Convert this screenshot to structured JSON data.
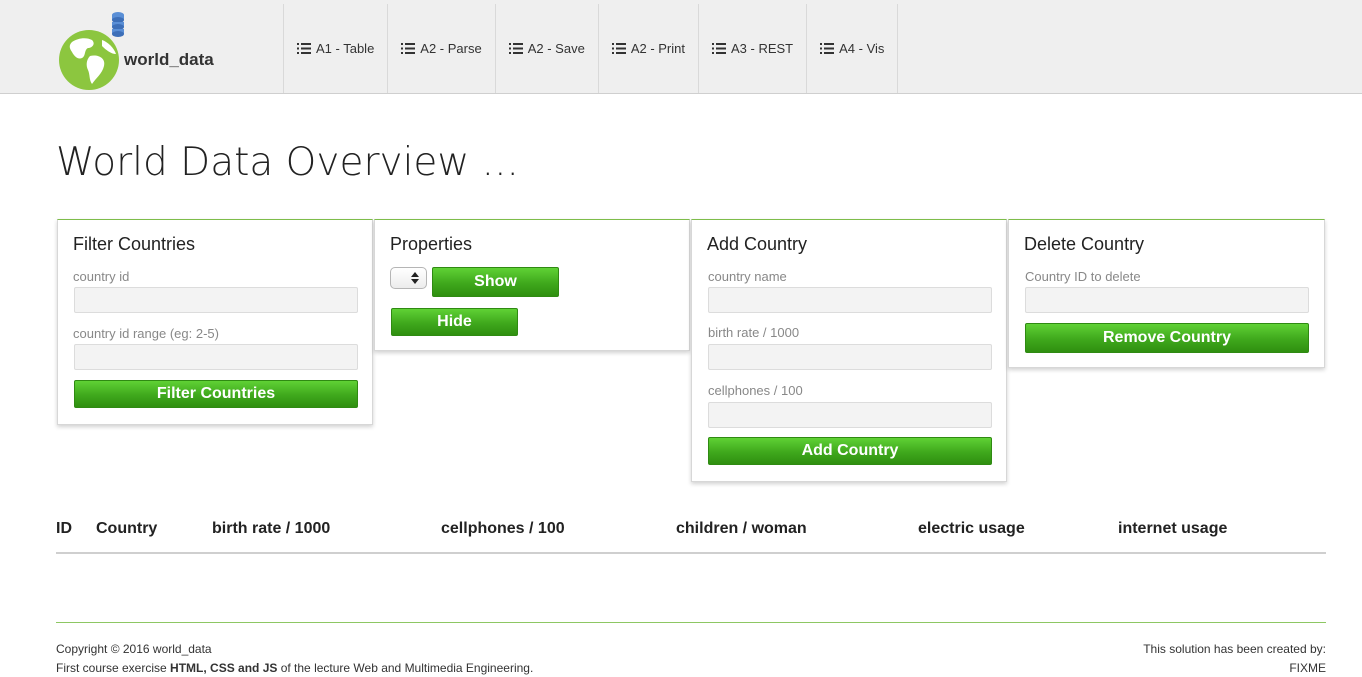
{
  "brand": {
    "name": "world_data"
  },
  "nav": {
    "items": [
      {
        "label": "A1 - Table"
      },
      {
        "label": "A2 - Parse"
      },
      {
        "label": "A2 - Save"
      },
      {
        "label": "A2 - Print"
      },
      {
        "label": "A3 - REST"
      },
      {
        "label": "A4 - Vis"
      }
    ]
  },
  "page": {
    "title": "World Data Overview ..."
  },
  "filter_panel": {
    "title": "Filter Countries",
    "id_label": "country id",
    "range_label": "country id range (eg: 2-5)",
    "button": "Filter Countries"
  },
  "properties_panel": {
    "title": "Properties",
    "show_button": "Show",
    "hide_button": "Hide"
  },
  "add_panel": {
    "title": "Add Country",
    "name_label": "country name",
    "birth_label": "birth rate / 1000",
    "cell_label": "cellphones / 100",
    "button": "Add Country"
  },
  "delete_panel": {
    "title": "Delete Country",
    "id_label": "Country ID to delete",
    "button": "Remove Country"
  },
  "table": {
    "columns": [
      "ID",
      "Country",
      "birth rate / 1000",
      "cellphones / 100",
      "children / woman",
      "electric usage",
      "internet usage"
    ]
  },
  "footer": {
    "copyright": "Copyright © 2016 world_data",
    "course_prefix": "First course exercise ",
    "course_bold": "HTML, CSS and JS",
    "course_suffix": " of the lecture Web and Multimedia Engineering.",
    "created_by": "This solution has been created by:",
    "author": "FIXME"
  },
  "colors": {
    "accent_green": "#3fa81c",
    "panel_top_border": "#7ebd4a",
    "navbar_bg": "#efefef"
  }
}
